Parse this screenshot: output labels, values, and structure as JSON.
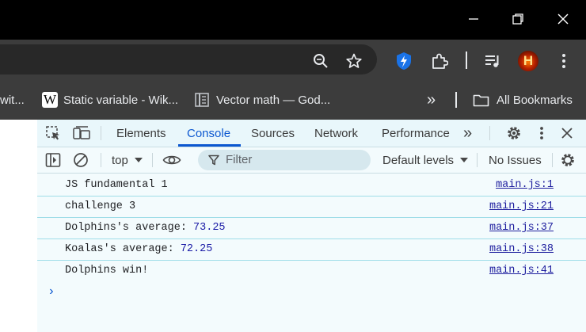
{
  "window": {
    "minimize_icon": "minimize-icon",
    "restore_icon": "restore-icon",
    "close_icon": "close-icon"
  },
  "toolbar": {
    "zoom_icon": "zoom-out-icon",
    "bookmark_icon": "star-icon",
    "extensions": [
      "bolt-extension-icon",
      "puzzle-extensions-icon",
      "media-queue-icon",
      "profile-avatar-icon"
    ],
    "avatar_letter": "H",
    "menu_icon": "kebab-menu-icon"
  },
  "bookmarks": {
    "items": [
      {
        "label": "wit..."
      },
      {
        "label": "Static variable - Wik...",
        "icon": "W"
      },
      {
        "label": "Vector math — God...",
        "icon": "book-icon"
      }
    ],
    "overflow": "»",
    "all_bookmarks": "All Bookmarks"
  },
  "devtools": {
    "tabs": [
      "Elements",
      "Console",
      "Sources",
      "Network",
      "Performance"
    ],
    "active_tab": "Console",
    "more_tabs": "»",
    "context": "top",
    "filter_placeholder": "Filter",
    "levels": "Default levels",
    "issues": "No Issues",
    "accent": "#0b57d0"
  },
  "console": {
    "rows": [
      {
        "text": "JS fundamental 1",
        "source": "main.js:1"
      },
      {
        "text": "challenge 3",
        "source": "main.js:21"
      },
      {
        "text": "Dolphins's average: ",
        "value": "73.25",
        "source": "main.js:37"
      },
      {
        "text": "Koalas's average: ",
        "value": "72.25",
        "source": "main.js:38"
      },
      {
        "text": "Dolphins win!",
        "source": "main.js:41"
      }
    ],
    "prompt": "›"
  }
}
